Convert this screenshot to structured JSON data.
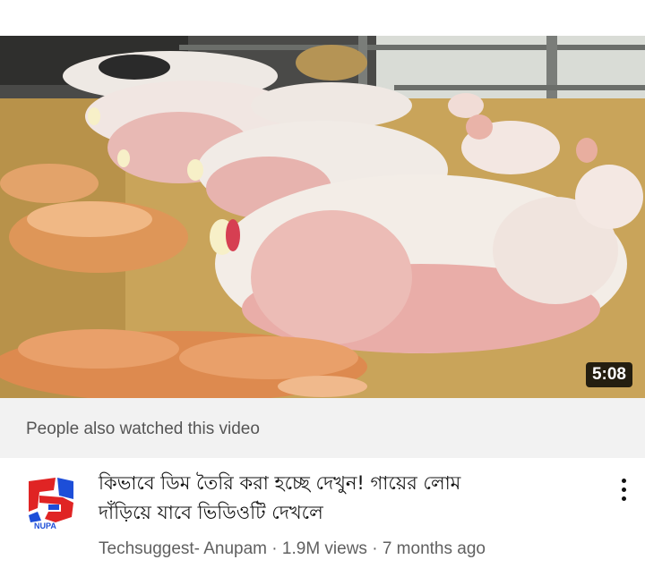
{
  "video": {
    "duration": "5:08",
    "title_line1": "কিভাবে ডিম তৈরি করা হচ্ছে দেখুন! গায়ের লোম",
    "title_line2": "দাঁড়িয়ে যাবে ভিডিওটি দেখলে",
    "channel": "Techsuggest- Anupam",
    "views": "1.9M views",
    "age": "7 months ago",
    "separator": " · "
  },
  "section": {
    "label": "People also watched this video"
  },
  "channel_avatar": {
    "text": "NUPA",
    "colors": {
      "red": "#e02424",
      "blue": "#1d4ed8"
    }
  },
  "icons": {
    "more": "more-vertical-icon"
  }
}
